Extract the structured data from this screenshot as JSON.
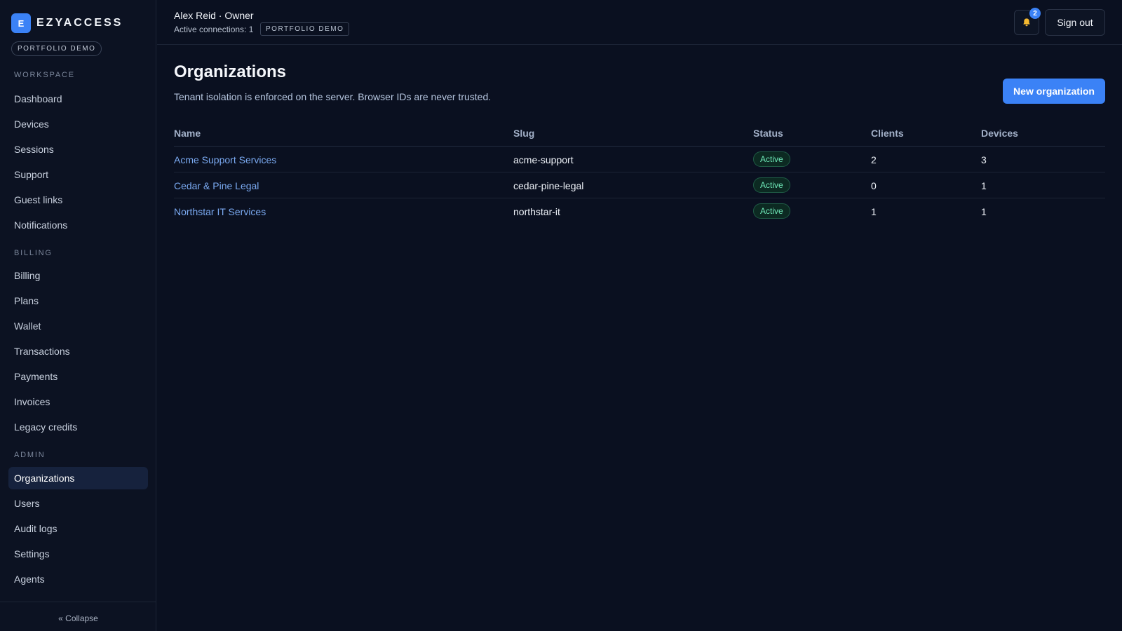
{
  "brand": {
    "logo_letter": "E",
    "name": "EZYACCESS",
    "tag": "PORTFOLIO DEMO"
  },
  "sidebar": {
    "sections": [
      {
        "title": "WORKSPACE",
        "items": [
          "Dashboard",
          "Devices",
          "Sessions",
          "Support",
          "Guest links",
          "Notifications"
        ]
      },
      {
        "title": "BILLING",
        "items": [
          "Billing",
          "Plans",
          "Wallet",
          "Transactions",
          "Payments",
          "Invoices",
          "Legacy credits"
        ]
      },
      {
        "title": "ADMIN",
        "items": [
          "Organizations",
          "Users",
          "Audit logs",
          "Settings",
          "Agents"
        ]
      }
    ],
    "active_item": "Organizations",
    "collapse_label": "« Collapse"
  },
  "header": {
    "user": "Alex Reid · Owner",
    "connections": "Active connections: 1",
    "demo_tag": "PORTFOLIO DEMO",
    "notifications_count": "2",
    "sign_out_label": "Sign out"
  },
  "page": {
    "title": "Organizations",
    "subtitle": "Tenant isolation is enforced on the server. Browser IDs are never trusted.",
    "new_button_label": "New organization"
  },
  "table": {
    "columns": [
      "Name",
      "Slug",
      "Status",
      "Clients",
      "Devices"
    ],
    "rows": [
      {
        "name": "Acme Support Services",
        "slug": "acme-support",
        "status": "Active",
        "clients": "2",
        "devices": "3"
      },
      {
        "name": "Cedar & Pine Legal",
        "slug": "cedar-pine-legal",
        "status": "Active",
        "clients": "0",
        "devices": "1"
      },
      {
        "name": "Northstar IT Services",
        "slug": "northstar-it",
        "status": "Active",
        "clients": "1",
        "devices": "1"
      }
    ]
  },
  "icons": {
    "bell": "bell-icon"
  },
  "colors": {
    "accent": "#3b82f6",
    "status_active": "#6ee7b7",
    "link": "#7aa9f0",
    "background": "#0a1020"
  }
}
